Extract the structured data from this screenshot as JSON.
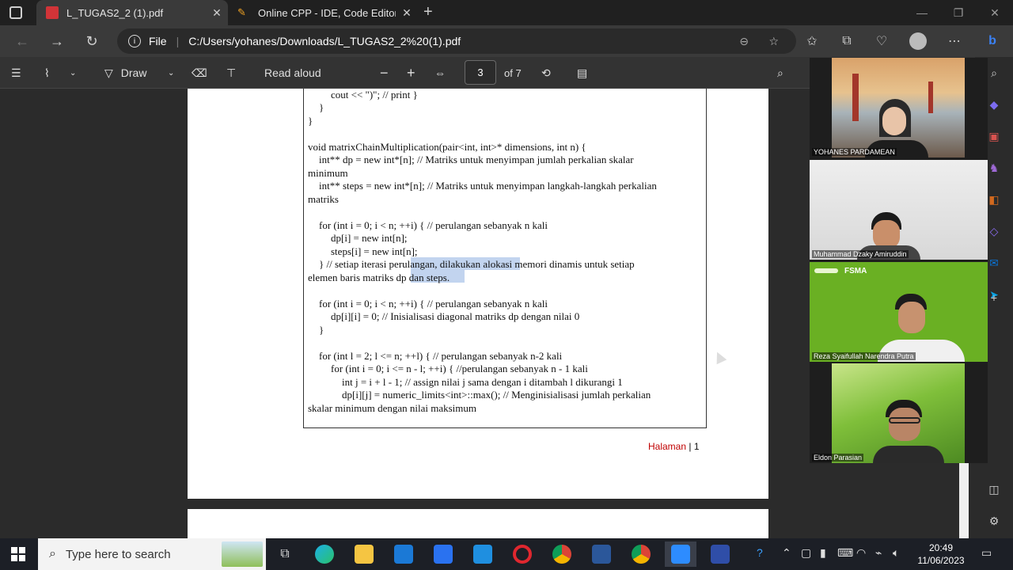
{
  "tabs": [
    {
      "title": "L_TUGAS2_2 (1).pdf",
      "icon": "pdf-icon",
      "active": true
    },
    {
      "title": "Online CPP - IDE, Code Editor, C",
      "icon": "cpp-site-icon",
      "active": false
    }
  ],
  "address": {
    "file_label": "File",
    "url": "C:/Users/yohanes/Downloads/L_TUGAS2_2%20(1).pdf"
  },
  "pdf_toolbar": {
    "draw_label": "Draw",
    "read_aloud_label": "Read aloud",
    "page_current": "3",
    "page_total": "of 7"
  },
  "code_lines": [
    "cout << \")\"; // print }",
    "}",
    "}",
    "",
    "void matrixChainMultiplication(pair<int, int>* dimensions, int n) {",
    "int** dp = new int*[n]; // Matriks untuk menyimpan jumlah perkalian skalar",
    "minimum",
    "int** steps = new int*[n]; // Matriks untuk menyimpan langkah-langkah perkalian",
    "matriks",
    "",
    "for (int i = 0; i < n; ++i) { // perulangan sebanyak n kali",
    "dp[i] = new int[n];",
    "steps[i] = new int[n];",
    "} // setiap iterasi perulangan, dilakukan alokasi memori dinamis untuk setiap",
    "elemen baris matriks dp dan steps.",
    "",
    "for (int i = 0; i < n; ++i) { // perulangan sebanyak n kali",
    "dp[i][i] = 0; // Inisialisasi diagonal matriks dp dengan nilai 0",
    "}",
    "",
    "for (int l = 2; l <= n; ++l) { // perulangan sebanyak n-2 kali",
    "for (int i = 0; i <= n - l; ++i) { //perulangan sebanyak n - 1 kali",
    "int j = i + l - 1; // assign nilai j sama dengan i ditambah l dikurangi 1",
    "dp[i][j] = numeric_limits<int>::max(); // Menginisialisasi jumlah perkalian",
    "skalar minimum dengan nilai maksimum"
  ],
  "footer": {
    "label": "Halaman",
    "separator": "|",
    "number": "1"
  },
  "participants": [
    {
      "name": "YOHANES PARDAMEAN"
    },
    {
      "name": "Muhammad Dzaky Amiruddin"
    },
    {
      "name": "Reza Syaifullah Narendra Putra",
      "banner": "FSMA"
    },
    {
      "name": "Eldon Parasian"
    }
  ],
  "taskbar": {
    "search_placeholder": "Type here to search",
    "time": "20:49",
    "date": "11/06/2023"
  },
  "colors": {
    "accent": "#0078d4",
    "footer_label": "#c00000"
  }
}
